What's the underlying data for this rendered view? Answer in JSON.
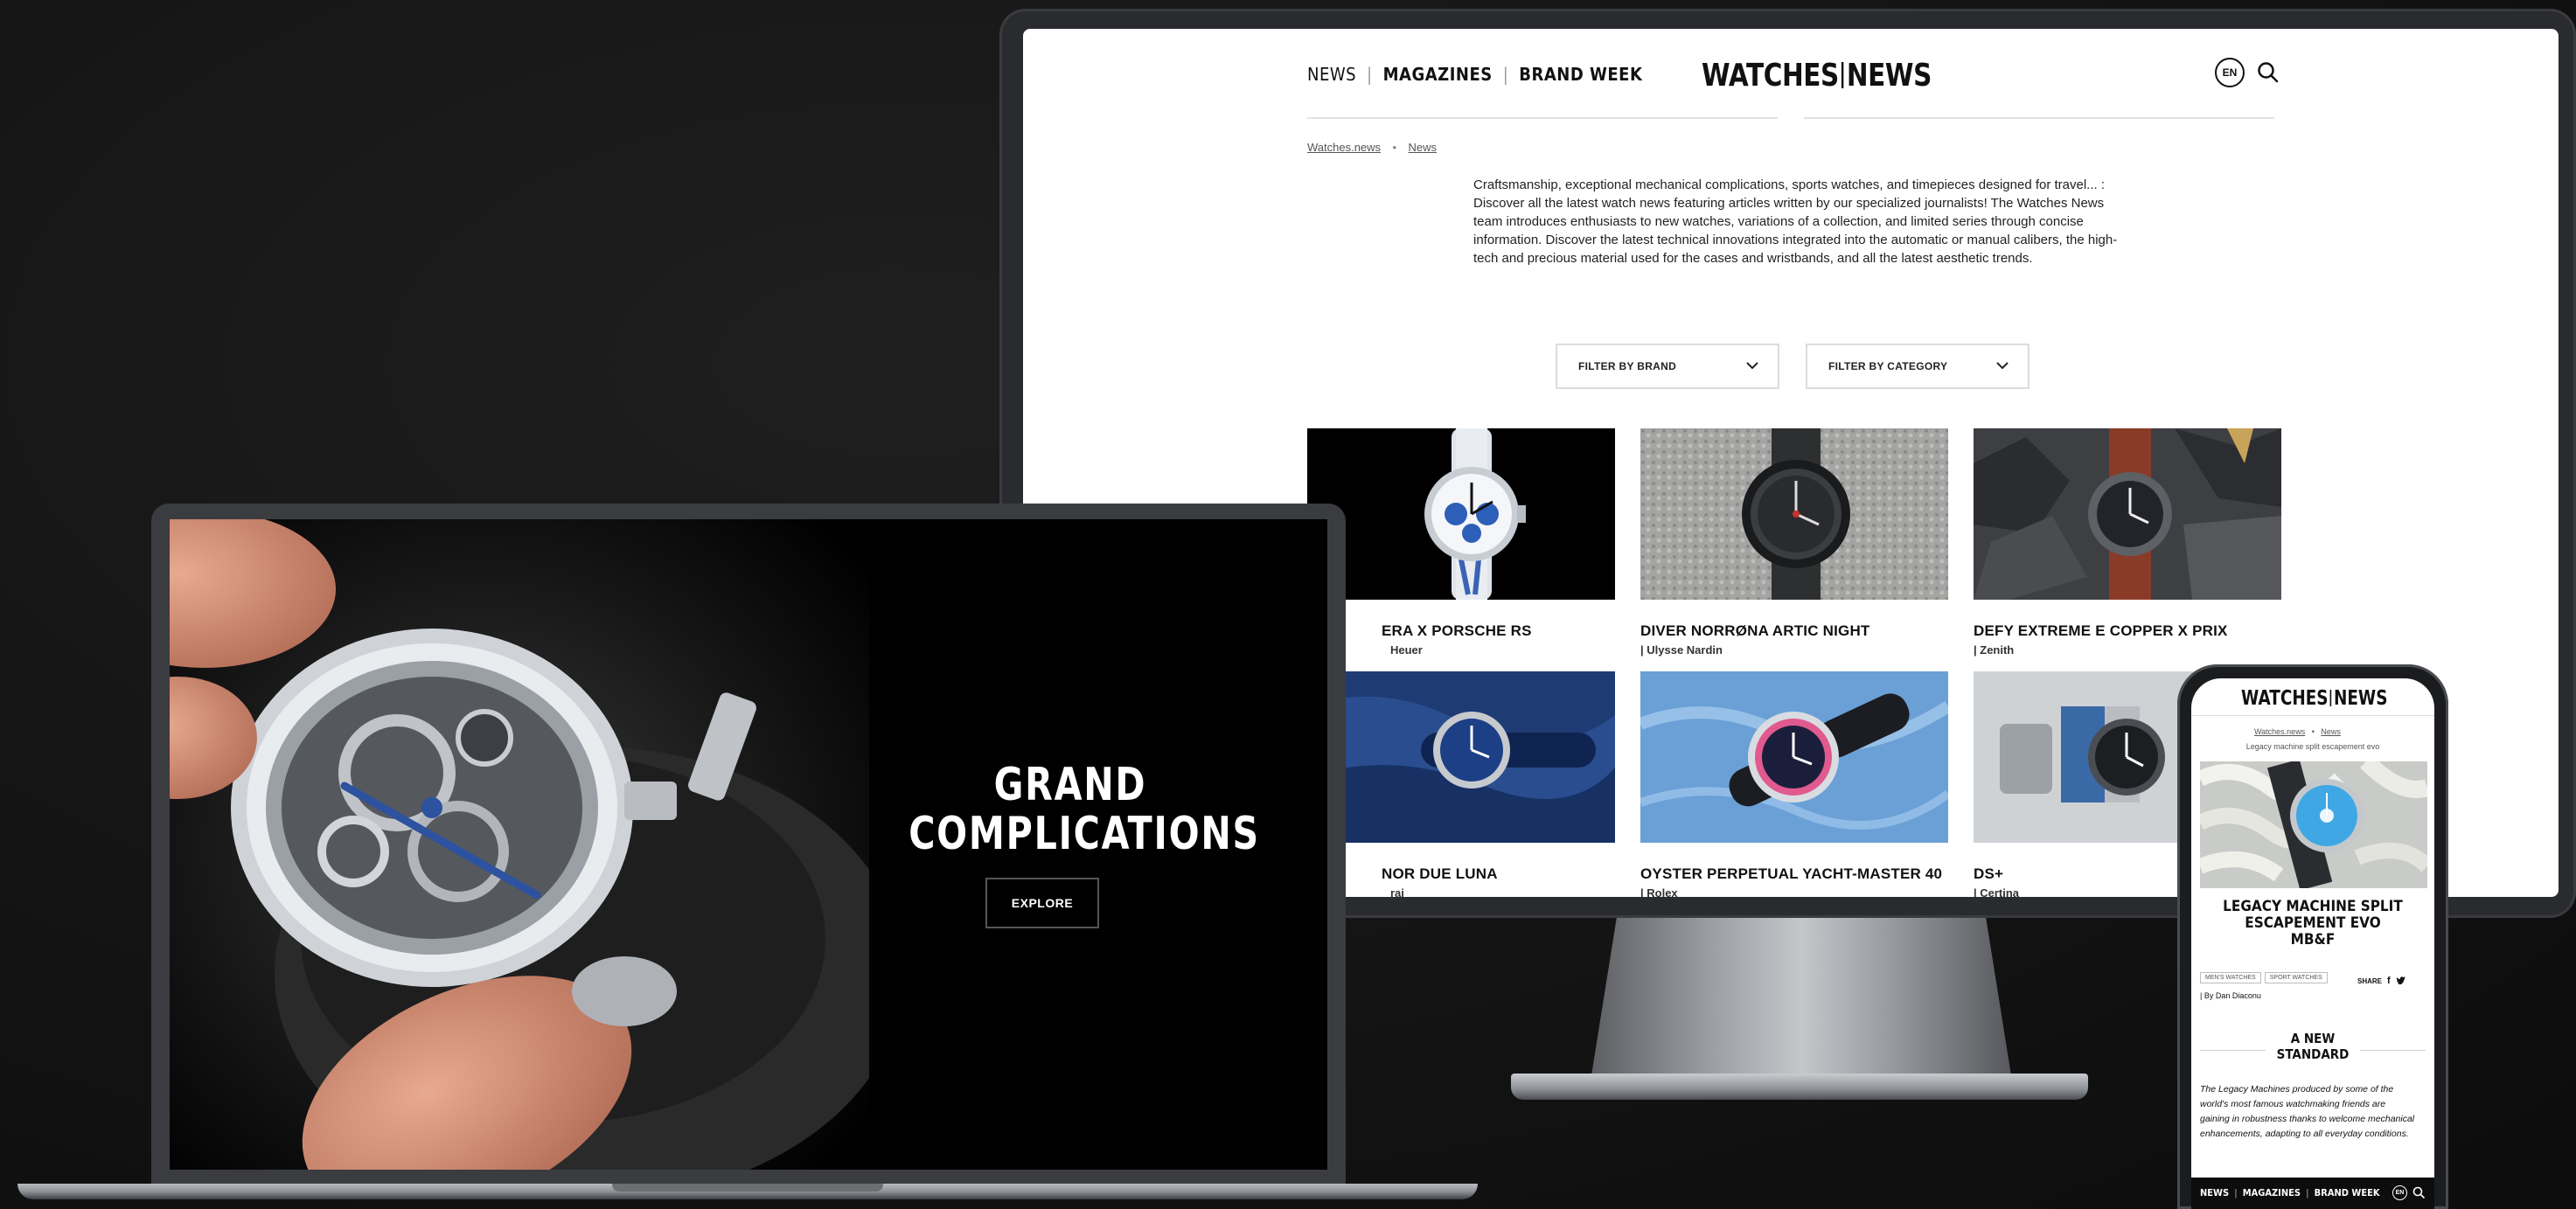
{
  "desktop": {
    "nav": {
      "news": "NEWS",
      "magazines": "MAGAZINES",
      "brand_week": "BRAND WEEK"
    },
    "logo_left": "WATCHES",
    "logo_right": "NEWS",
    "lang": "EN",
    "breadcrumb": {
      "home": "Watches.news",
      "current": "News"
    },
    "intro": "Craftsmanship, exceptional mechanical complications, sports watches, and timepieces designed for travel... : Discover all the latest watch news featuring articles written by our specialized journalists! The Watches News team introduces enthusiasts to new watches, variations of a collection, and limited series through concise information. Discover the latest technical innovations integrated into the automatic or manual calibers, the high-tech and precious material used for the cases and wristbands, and all the latest aesthetic trends.",
    "filters": {
      "brand": "FILTER BY BRAND",
      "category": "FILTER BY CATEGORY"
    },
    "cards": [
      {
        "title": "ERA X PORSCHE RS",
        "brand": "Heuer"
      },
      {
        "title": "DIVER NORRØNA ARTIC NIGHT",
        "brand": "| Ulysse Nardin"
      },
      {
        "title": "DEFY EXTREME E COPPER X PRIX",
        "brand": "| Zenith"
      },
      {
        "title": "NOR DUE LUNA",
        "brand": "rai"
      },
      {
        "title": "OYSTER PERPETUAL YACHT-MASTER 40",
        "brand": "| Rolex"
      },
      {
        "title": "DS+",
        "brand": "| Certina"
      }
    ]
  },
  "laptop": {
    "hero_line1": "GRAND",
    "hero_line2": "COMPLICATIONS",
    "cta": "EXPLORE"
  },
  "phone": {
    "logo_left": "WATCHES",
    "logo_right": "NEWS",
    "breadcrumb": {
      "home": "Watches.news",
      "current": "News"
    },
    "subtitle": "Legacy machine split escapement evo",
    "title_line1": "LEGACY MACHINE SPLIT",
    "title_line2": "ESCAPEMENT EVO",
    "title_line3": "MB&F",
    "tags": [
      "MEN'S WATCHES",
      "SPORT WATCHES"
    ],
    "share": "SHARE",
    "author": "| By Dan Diaconu",
    "section_line1": "A NEW",
    "section_line2": "STANDARD",
    "body": "The Legacy Machines produced by some of the world's most famous watchmaking friends are gaining in robustness thanks to welcome mechanical enhancements, adapting to all everyday conditions.",
    "nav": {
      "news": "NEWS",
      "magazines": "MAGAZINES",
      "brand_week": "BRAND WEEK"
    },
    "lang": "EN"
  },
  "colors": {
    "background": "#141414",
    "ink": "#111111",
    "page": "#ffffff"
  }
}
